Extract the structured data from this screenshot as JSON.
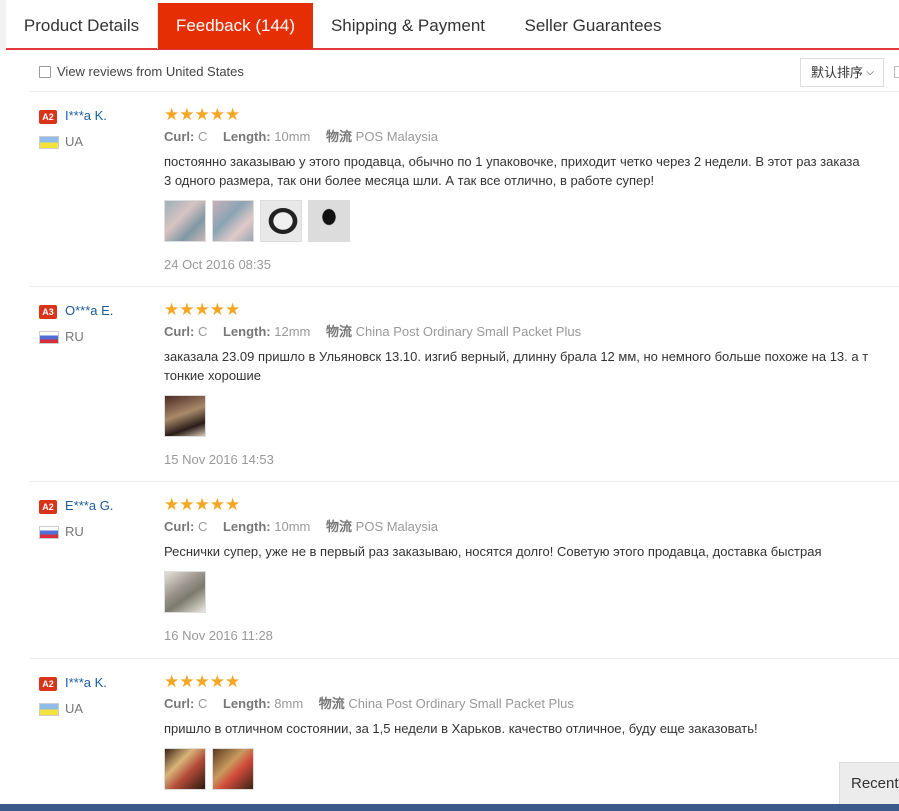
{
  "tabs": {
    "details": "Product Details",
    "feedback": "Feedback (144)",
    "shipping": "Shipping & Payment",
    "seller": "Seller Guarantees"
  },
  "filter": {
    "view_label": "View reviews from United States",
    "sort_label": "默认排序"
  },
  "labels": {
    "curl": "Curl:",
    "length": "Length:",
    "logistics": "物流"
  },
  "reviews": [
    {
      "level": "A2",
      "name": "I***a K.",
      "country": "UA",
      "rating": 5,
      "stars": "★★★★★",
      "curl": "C",
      "length": "10mm",
      "logistics": "POS Malaysia",
      "text_lines": [
        "постоянно заказываю у этого продавца, обычно по 1 упаковочке, приходит четко через 2 недели. В этот раз заказа",
        "3 одного размера, так они более месяца шли. А так все отлично, в работе супер!"
      ],
      "date": "24 Oct 2016 08:35"
    },
    {
      "level": "A3",
      "name": "O***a E.",
      "country": "RU",
      "rating": 5,
      "stars": "★★★★★",
      "curl": "C",
      "length": "12mm",
      "logistics": "China Post Ordinary Small Packet Plus",
      "text_lines": [
        "заказала 23.09 пришло в Ульяновск 13.10. изгиб верный, длинну брала 12 мм, но немного больше похоже на 13. а т",
        "тонкие хорошие"
      ],
      "date": "15 Nov 2016 14:53"
    },
    {
      "level": "A2",
      "name": "E***a G.",
      "country": "RU",
      "rating": 5,
      "stars": "★★★★★",
      "curl": "C",
      "length": "10mm",
      "logistics": "POS Malaysia",
      "text_lines": [
        "Реснички супер, уже не в первый раз заказываю, носятся долго! Советую этого продавца, доставка быстрая"
      ],
      "date": "16 Nov 2016 11:28"
    },
    {
      "level": "A2",
      "name": "I***a K.",
      "country": "UA",
      "rating": 5,
      "stars": "★★★★★",
      "curl": "C",
      "length": "8mm",
      "logistics": "China Post Ordinary Small Packet Plus",
      "text_lines": [
        "пришло в отличном состоянии, за 1,5 недели в Харьков. качество отличное, буду еще заказовать!"
      ]
    }
  ],
  "recently_label": "Recentl",
  "colors": {
    "accent": "#e62e04",
    "star": "#f5a623",
    "link": "#1a5c9e"
  }
}
